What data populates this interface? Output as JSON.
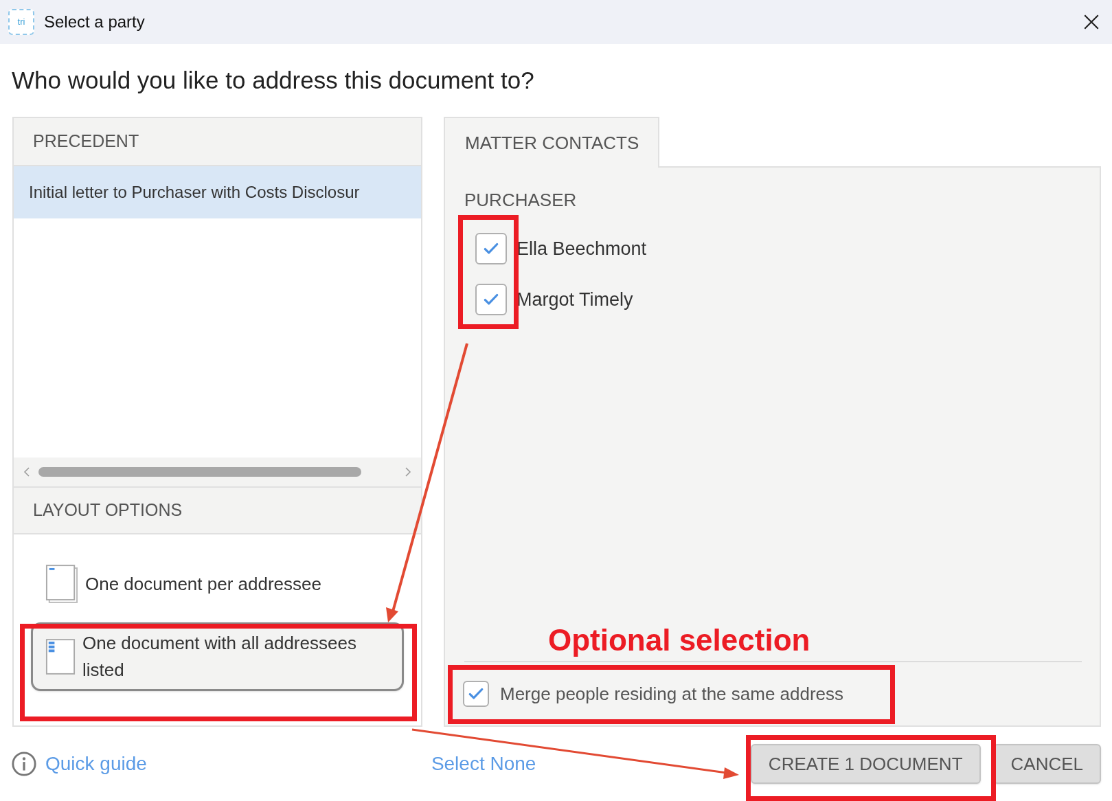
{
  "window": {
    "logo": "tri",
    "title": "Select a party"
  },
  "heading": "Who would you like to address this document to?",
  "precedent": {
    "header": "PRECEDENT",
    "items": [
      {
        "label": "Initial letter to Purchaser with Costs Disclosur",
        "selected": true
      }
    ]
  },
  "layout_options": {
    "header": "LAYOUT OPTIONS",
    "options": [
      {
        "label": "One document per addressee",
        "kind": "per-addressee",
        "selected": false
      },
      {
        "label": "One document with all addressees listed",
        "kind": "combined",
        "selected": true
      }
    ]
  },
  "tabs": [
    {
      "label": "MATTER CONTACTS",
      "selected": true
    }
  ],
  "contacts": {
    "groups": [
      {
        "label": "PURCHASER",
        "people": [
          {
            "name": "Ella Beechmont",
            "checked": true
          },
          {
            "name": "Margot Timely",
            "checked": true
          }
        ]
      }
    ]
  },
  "annotation": {
    "text": "Optional selection"
  },
  "merge_option": {
    "label": "Merge people residing at the same address",
    "checked": true
  },
  "footer": {
    "quick_guide": "Quick guide",
    "select_none": "Select None",
    "buttons": [
      {
        "label": "CREATE 1 DOCUMENT"
      },
      {
        "label": "CANCEL"
      }
    ]
  }
}
